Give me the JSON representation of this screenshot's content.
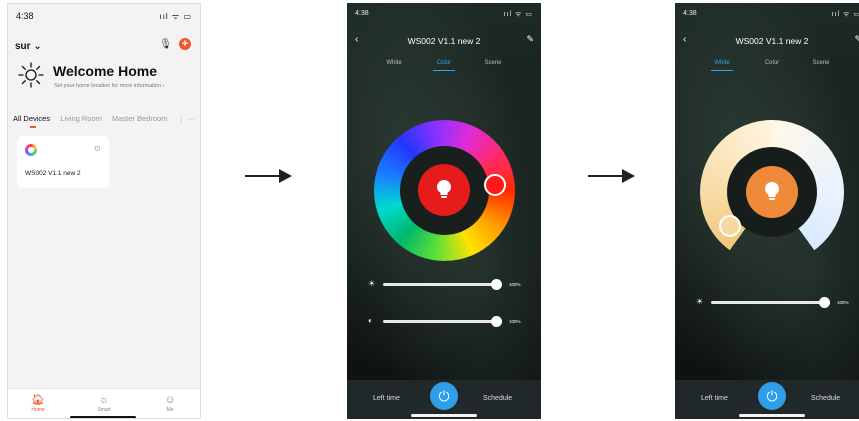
{
  "home": {
    "time": "4:38",
    "status_icons": "ııl ᯤ ▭",
    "location": "sur",
    "welcome_title": "Welcome Home",
    "welcome_sub": "Set your home location for more information",
    "tabs": [
      "All Devices",
      "Living Room",
      "Master Bedroom",
      "⋮ ···"
    ],
    "device_name": "WS002 V1.1 new 2",
    "nav": [
      {
        "label": "Home",
        "icon": "house-icon"
      },
      {
        "label": "Smart",
        "icon": "sun-icon"
      },
      {
        "label": "Me",
        "icon": "profile-icon"
      }
    ]
  },
  "color_screen": {
    "time": "4:38",
    "status_icons": "ııl ᯤ ▭",
    "title": "WS002 V1.1 new 2",
    "tabs": [
      "White",
      "Color",
      "Scene"
    ],
    "active_tab": "Color",
    "bulb_color": "#e61b1b",
    "selected_hue_color": "#ff1a1a",
    "brightness_pct": "100%",
    "saturation_pct": "100%",
    "brightness_value": 1.0,
    "saturation_value": 1.0,
    "left_label": "Left time",
    "right_label": "Schedule"
  },
  "white_screen": {
    "time": "4:38",
    "status_icons": "ııl ᯤ ▭",
    "title": "WS002 V1.1 new 2",
    "tabs": [
      "White",
      "Color",
      "Scene"
    ],
    "active_tab": "White",
    "bulb_color": "#ef8a38",
    "brightness_pct": "100%",
    "brightness_value": 1.0,
    "left_label": "Left time",
    "right_label": "Schedule"
  },
  "colors": {
    "accent_orange": "#f0572a",
    "accent_blue": "#2f9ee8"
  }
}
